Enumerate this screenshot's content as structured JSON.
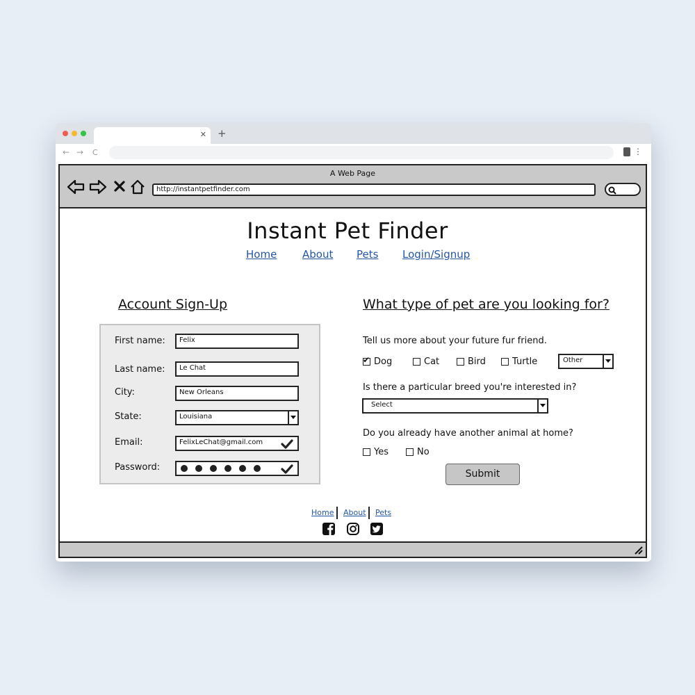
{
  "balsamiq": {
    "window_title": "A Web Page",
    "url": "http://instantpetfinder.com"
  },
  "site": {
    "title": "Instant Pet Finder",
    "nav": [
      "Home",
      "About",
      "Pets",
      "Login/Signup"
    ]
  },
  "signup": {
    "heading": "Account Sign-Up",
    "fields": {
      "first_name": {
        "label": "First name:",
        "value": "Felix"
      },
      "last_name": {
        "label": "Last name:",
        "value": "Le Chat"
      },
      "city": {
        "label": "City:",
        "value": "New Orleans"
      },
      "state": {
        "label": "State:",
        "value": "Louisiana"
      },
      "email": {
        "label": "Email:",
        "value": "FelixLeChat@gmail.com"
      },
      "password": {
        "label": "Password:",
        "masked_length": 6
      }
    }
  },
  "pet": {
    "heading": "What type of pet are you looking for?",
    "q1": "Tell us more about your future fur friend.",
    "types": [
      {
        "label": "Dog",
        "checked": true
      },
      {
        "label": "Cat",
        "checked": false
      },
      {
        "label": "Bird",
        "checked": false
      },
      {
        "label": "Turtle",
        "checked": false
      }
    ],
    "other_select": "Other",
    "q2": "Is there a particular breed you're interested in?",
    "breed_select": "Select",
    "q3": "Do you already have another animal at home?",
    "yes": "Yes",
    "no": "No",
    "submit": "Submit"
  },
  "footer": {
    "links": [
      "Home",
      "About",
      "Pets"
    ],
    "social": [
      "facebook-icon",
      "instagram-icon",
      "twitter-icon"
    ]
  }
}
